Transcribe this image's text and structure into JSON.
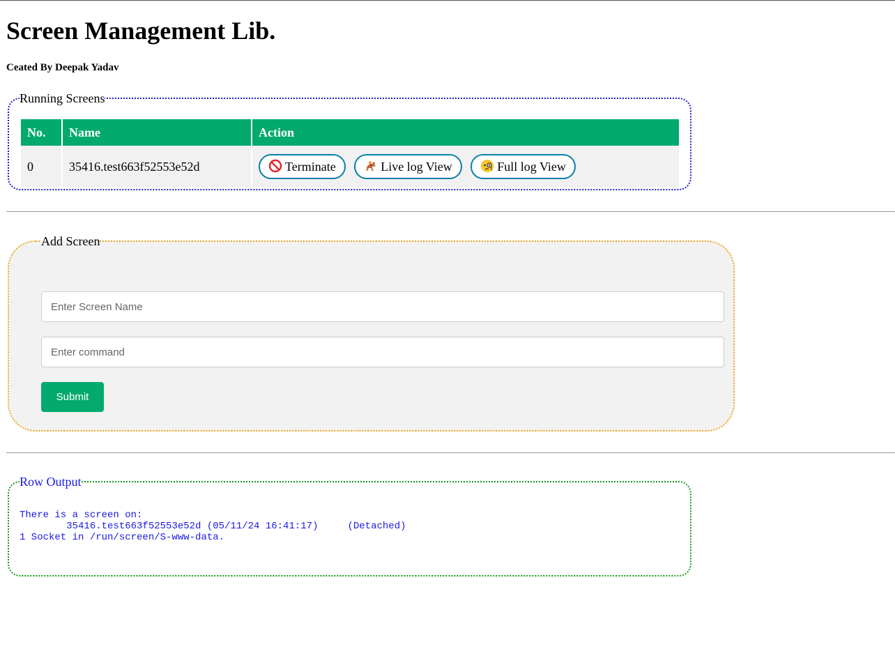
{
  "header": {
    "title": "Screen Management Lib.",
    "author": "Ceated By Deepak Yadav"
  },
  "running_screens": {
    "legend": "Running Screens",
    "columns": [
      "No.",
      "Name",
      "Action"
    ],
    "rows": [
      {
        "no": "0",
        "name": "35416.test663f52553e52d",
        "actions": {
          "terminate": {
            "label": "Terminate",
            "icon": "no-entry-icon"
          },
          "live_log": {
            "label": "Live log View",
            "icon": "horse-racing-icon"
          },
          "full_log": {
            "label": "Full log View",
            "icon": "monocle-face-icon"
          }
        }
      }
    ],
    "header_color": "#04aa6d"
  },
  "add_screen": {
    "legend": "Add Screen",
    "name_input": {
      "placeholder": "Enter Screen Name",
      "value": ""
    },
    "command_input": {
      "placeholder": "Enter command",
      "value": ""
    },
    "submit_label": "Submit",
    "button_color": "#04aa6d"
  },
  "row_output": {
    "legend": "Row Output",
    "lines": [
      "There is a screen on:",
      "\t35416.test663f52553e52d\t(05/11/24 16:41:17)\t(Detached)",
      "1 Socket in /run/screen/S-www-data."
    ]
  }
}
